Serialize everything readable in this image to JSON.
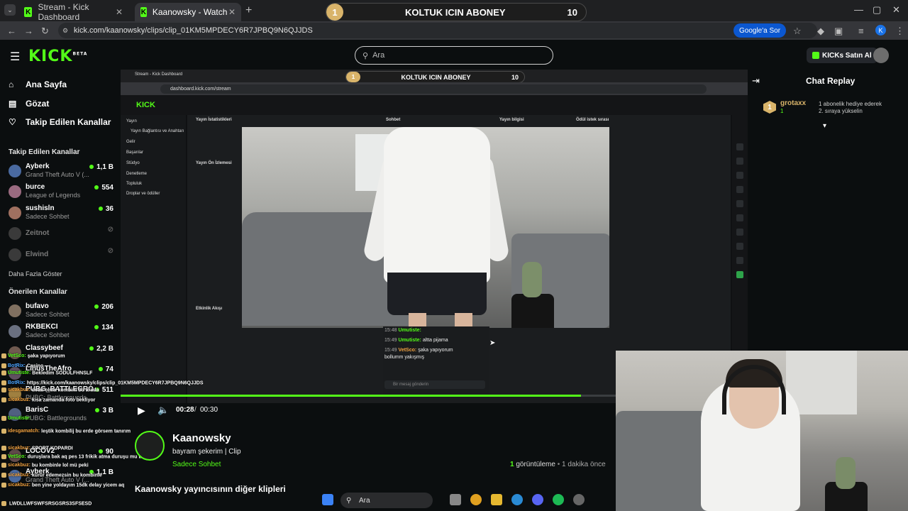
{
  "browser": {
    "tabs": [
      {
        "label": "Stream - Kick Dashboard"
      },
      {
        "label": "Kaanowsky - Watch clips on Kic"
      }
    ],
    "url": "kick.com/kaanowsky/clips/clip_01KM5MPDECY6R7JPBQ9N6QJJDS",
    "google_button": "Google'a Sor",
    "profile_letter": "K"
  },
  "overlay_banner": {
    "left_number": "1",
    "text": "KOLTUK ICIN ABONEY",
    "right_number": "10"
  },
  "kick": {
    "logo": "KICK",
    "logo_beta": "BETA",
    "search_placeholder": "Ara",
    "buy_kicks": "KICKs Satın Al"
  },
  "sidebar": {
    "nav": [
      {
        "label": "Ana Sayfa",
        "icon": "home-icon"
      },
      {
        "label": "Gözat",
        "icon": "browse-icon"
      },
      {
        "label": "Takip Edilen Kanallar",
        "icon": "heart-icon"
      }
    ],
    "followed_title": "Takip Edilen Kanallar",
    "followed": [
      {
        "name": "Ayberk",
        "category": "Grand Theft Auto V (...",
        "viewers": "1,1 B"
      },
      {
        "name": "burce",
        "category": "League of Legends",
        "viewers": "554"
      },
      {
        "name": "sushisln",
        "category": "Sadece Sohbet",
        "viewers": "36"
      },
      {
        "name": "Zeitnot",
        "category": "",
        "viewers": ""
      },
      {
        "name": "Elwind",
        "category": "",
        "viewers": ""
      }
    ],
    "show_more": "Daha Fazla Göster",
    "recommended_title": "Önerilen Kanallar",
    "recommended": [
      {
        "name": "bufavo",
        "category": "Sadece Sohbet",
        "viewers": "206"
      },
      {
        "name": "RKBEKCI",
        "category": "Sadece Sohbet",
        "viewers": "134"
      },
      {
        "name": "Classybeef",
        "category": "",
        "viewers": "2,2 B"
      },
      {
        "name": "LinusTheAfro",
        "category": "",
        "viewers": "74"
      },
      {
        "name": "PUBG_BATTLEGRO...",
        "category": "PUBG: Battlegrounds",
        "viewers": "511"
      },
      {
        "name": "BarisC",
        "category": "PUBG: Battlegrounds",
        "viewers": "3 B"
      },
      {
        "name": "LOCOV2",
        "category": "",
        "viewers": "90"
      },
      {
        "name": "Ayberk",
        "category": "Grand Theft Auto V (...",
        "viewers": "1,1 B"
      }
    ]
  },
  "inner_capture": {
    "url": "dashboard.kick.com/stream",
    "tabs": [
      {
        "label": "Stream - Kick Dashboard"
      }
    ],
    "logo": "KICK",
    "side_items": [
      "Yayın",
      "Yayın Bağlantısı ve Anahtarı",
      "Gelir",
      "Başarılar",
      "Stüdyo",
      "Denetleme",
      "Topluluk",
      "Droplar ve ödüller"
    ],
    "panel_titles": [
      "Yayın İstatistikleri",
      "Sohbet",
      "Yayın bilgisi",
      "Ödül istek sırası"
    ],
    "preview_title": "Yayın Ön İzlemesi",
    "activity_title": "Etkinlik Akışı",
    "chat": [
      {
        "time": "15:48",
        "user": "Umutiste:",
        "text": ""
      },
      {
        "time": "15:49",
        "user": "Umutiste:",
        "text": "altta pijama"
      },
      {
        "time": "15:49",
        "user": "VetSco:",
        "text": "şaka yapıyorum"
      },
      {
        "time": "",
        "user": "",
        "text": "bollumm yakışmış"
      }
    ],
    "chat_placeholder": "Bir mesaj gönderin"
  },
  "player": {
    "time_current": "00:28",
    "time_separator": "/",
    "time_total": "00:30",
    "progress_fraction": 0.93
  },
  "clip": {
    "channel": "Kaanowsky",
    "title": "bayram şekerim | Clip",
    "category": "Sadece Sohbet",
    "views_number": "1",
    "views_label": "görüntüleme",
    "age": "1 dakika önce",
    "more_title": "Kaanowsky yayıncısının diğer klipleri"
  },
  "chat_replay": {
    "title": "Chat Replay",
    "gift": {
      "badge": "1",
      "user": "grotaxx",
      "count": "1",
      "text_line1": "1 abonelik hediye ederek",
      "text_line2": "2. sıraya yükselin"
    }
  },
  "overlay_chat": [
    {
      "user": "VetSco:",
      "text": "şaka yapıyorum",
      "color": "g"
    },
    {
      "user": "BotRix:",
      "text": "Casino",
      "color": "b"
    },
    {
      "user": "Umutiste:",
      "text": "Bekledim SODULFHNSLF",
      "color": "g"
    },
    {
      "user": "BotRix:",
      "text": "https://kick.com/kaanowsky/clips/clip_01KM5MPDECY6R7JPBQ9N6QJJDS",
      "color": "b"
    },
    {
      "user": "sicakbuz:",
      "text": "detal olma kombini bu arada",
      "color": "o"
    },
    {
      "user": "sicakbuz:",
      "text": "kısa zamanda foto bekliyor",
      "color": "o"
    },
    {
      "user": "Umutiste:",
      "text": "",
      "color": "g"
    },
    {
      "user": "idesgamatch:",
      "text": "leştik kombilij bu erde görsem tanırım",
      "color": "o"
    },
    {
      "user": "sicakbuz:",
      "text": "SPORT KOPARDI",
      "color": "o"
    },
    {
      "user": "VetSco:",
      "text": "duruşlara bak aq pes 13 frikik atma duruşu mu bu",
      "color": "g"
    },
    {
      "user": "sicakbuz:",
      "text": "bu kombinle lol mü peki",
      "color": "o"
    },
    {
      "user": "sicakbuz:",
      "text": "kürür edemezsin bu kombinle",
      "color": "o"
    },
    {
      "user": "sicakbuz:",
      "text": "ben yine yoldayım 15dk delay yicem aq",
      "color": "o"
    },
    {
      "user": "",
      "text": "LWDLLWFSWFSRSGSRS3SFSESD",
      "color": "g"
    }
  ],
  "taskbar": {
    "search_placeholder": "Ara"
  }
}
